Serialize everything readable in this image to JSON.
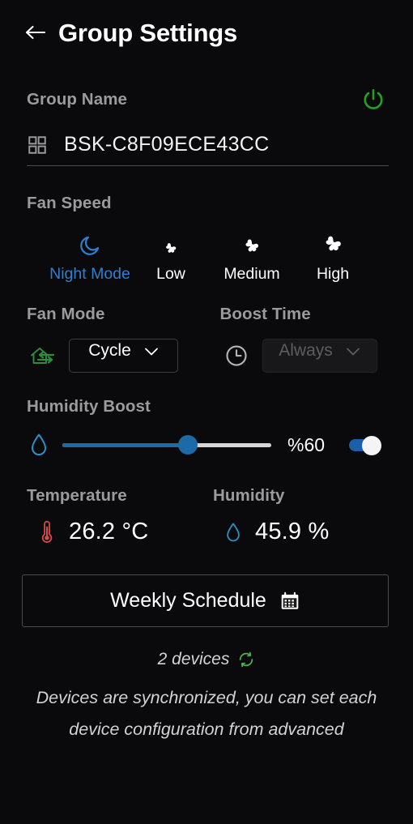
{
  "header": {
    "back_icon": "arrow-left-icon",
    "title": "Group Settings"
  },
  "group": {
    "label": "Group Name",
    "power_icon": "power-icon",
    "power_color": "#21a121",
    "grid_icon": "grid-icon",
    "name_value": "BSK-C8F09ECE43CC"
  },
  "fan_speed": {
    "label": "Fan Speed",
    "selected": "Night Mode",
    "accent_color": "#2f7fd1",
    "options": [
      {
        "label": "Night Mode",
        "icon": "moon-icon",
        "selected": true
      },
      {
        "label": "Low",
        "icon": "fan-icon",
        "selected": false
      },
      {
        "label": "Medium",
        "icon": "fan-icon",
        "selected": false
      },
      {
        "label": "High",
        "icon": "fan-icon",
        "selected": false
      }
    ]
  },
  "fan_mode": {
    "label": "Fan Mode",
    "icon": "house-airflow-icon",
    "icon_color": "#2f8c3f",
    "value": "Cycle",
    "chevron_icon": "chevron-down-icon"
  },
  "boost_time": {
    "label": "Boost Time",
    "icon": "clock-icon",
    "value": "Always",
    "chevron_icon": "chevron-down-icon",
    "disabled": true
  },
  "humidity_boost": {
    "label": "Humidity Boost",
    "icon": "water-drop-icon",
    "value": 60,
    "value_text": "%60",
    "min": 0,
    "max": 100,
    "fill_color": "#1d6aa8",
    "track_color": "#d6d6d6",
    "toggle_on": true
  },
  "readings": {
    "temperature": {
      "label": "Temperature",
      "icon": "thermometer-icon",
      "icon_color": "#d24a4a",
      "value": "26.2 °C"
    },
    "humidity": {
      "label": "Humidity",
      "icon": "water-drop-icon",
      "icon_color": "#2aa3c4",
      "value": "45.9 %"
    }
  },
  "schedule": {
    "label": "Weekly Schedule",
    "icon": "calendar-icon"
  },
  "footer": {
    "devices_text": "2 devices",
    "sync_icon": "sync-icon",
    "sync_color": "#4caf50",
    "note": "Devices are synchronized, you can set each device configuration from advanced"
  }
}
